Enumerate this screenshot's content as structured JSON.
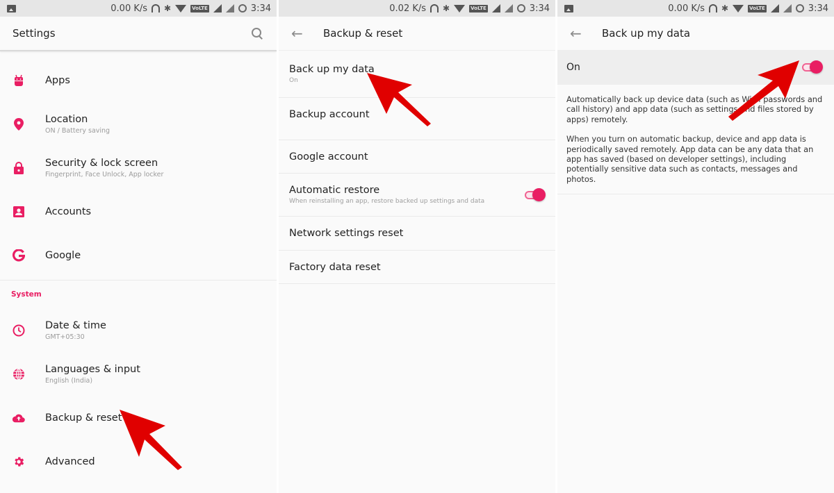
{
  "accent_color": "#e91e63",
  "annotation_color": "#e00000",
  "panels": [
    {
      "status_bar": {
        "notification_icon": "image-icon",
        "speed": "0.00 K/s",
        "volte": "VoLTE",
        "time": "3:34"
      },
      "app_bar": {
        "title": "Settings",
        "action_icon": "search-icon"
      },
      "items_top": [
        {
          "icon": "android-icon",
          "title": "Apps",
          "subtitle": ""
        },
        {
          "icon": "location-pin-icon",
          "title": "Location",
          "subtitle": "ON / Battery saving"
        },
        {
          "icon": "lock-icon",
          "title": "Security & lock screen",
          "subtitle": "Fingerprint, Face Unlock, App locker"
        },
        {
          "icon": "account-box-icon",
          "title": "Accounts",
          "subtitle": ""
        },
        {
          "icon": "google-g-icon",
          "title": "Google",
          "subtitle": ""
        }
      ],
      "section_header": "System",
      "items_system": [
        {
          "icon": "clock-icon",
          "title": "Date & time",
          "subtitle": "GMT+05:30"
        },
        {
          "icon": "globe-icon",
          "title": "Languages & input",
          "subtitle": "English (India)"
        },
        {
          "icon": "cloud-upload-icon",
          "title": "Backup & reset",
          "subtitle": ""
        },
        {
          "icon": "gear-icon",
          "title": "Advanced",
          "subtitle": ""
        }
      ]
    },
    {
      "status_bar": {
        "speed": "0.02 K/s",
        "volte": "VoLTE",
        "time": "3:34"
      },
      "app_bar": {
        "title": "Backup & reset",
        "back_icon": "back-arrow-icon"
      },
      "items": [
        {
          "title": "Back up my data",
          "subtitle": "On"
        },
        {
          "title": "Backup account",
          "subtitle": ""
        },
        {
          "title": "Google account",
          "subtitle": ""
        },
        {
          "title": "Automatic restore",
          "subtitle": "When reinstalling an app, restore backed up settings and data",
          "toggle_on": true
        },
        {
          "title": "Network settings reset",
          "subtitle": ""
        },
        {
          "title": "Factory data reset",
          "subtitle": ""
        }
      ]
    },
    {
      "status_bar": {
        "notification_icon": "image-icon",
        "speed": "0.00 K/s",
        "volte": "VoLTE",
        "time": "3:34"
      },
      "app_bar": {
        "title": "Back up my data",
        "back_icon": "back-arrow-icon"
      },
      "master_switch": {
        "label": "On",
        "toggle_on": true
      },
      "description": [
        "Automatically back up device data (such as Wi-Fi passwords and call history) and app data (such as settings and files stored by apps) remotely.",
        "When you turn on automatic backup, device and app data is periodically saved remotely. App data can be any data that an app has saved (based on developer settings), including potentially sensitive data such as contacts, messages and photos."
      ]
    }
  ]
}
